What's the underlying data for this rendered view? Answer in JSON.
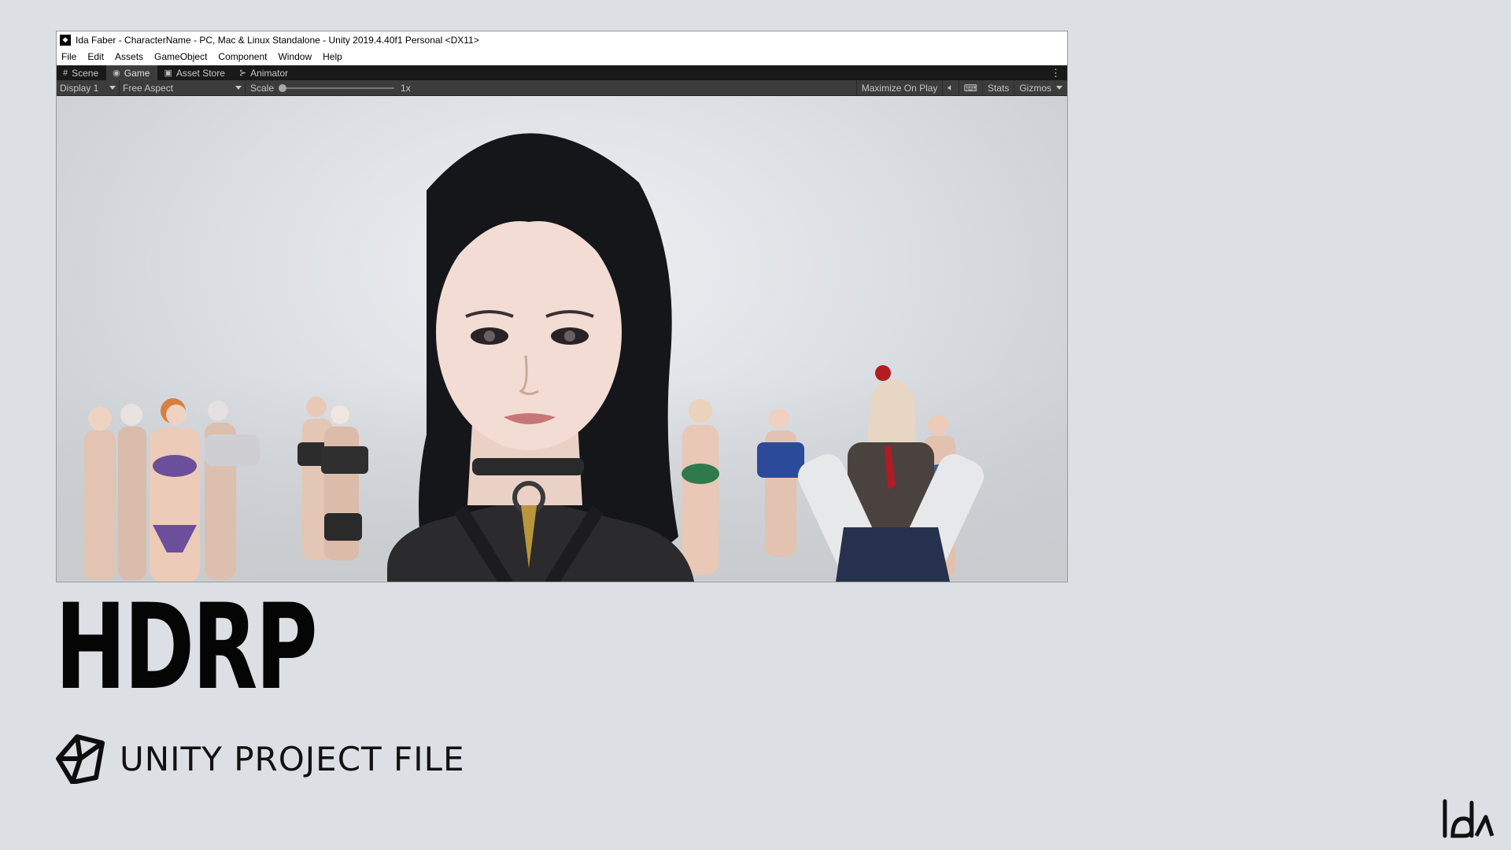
{
  "window": {
    "title": "Ida Faber - CharacterName - PC, Mac & Linux Standalone - Unity 2019.4.40f1 Personal <DX11>",
    "menu": [
      "File",
      "Edit",
      "Assets",
      "GameObject",
      "Component",
      "Window",
      "Help"
    ],
    "tabs": [
      {
        "label": "Scene",
        "icon": "grid-icon",
        "active": false
      },
      {
        "label": "Game",
        "icon": "gamepad-icon",
        "active": true
      },
      {
        "label": "Asset Store",
        "icon": "bag-icon",
        "active": false
      },
      {
        "label": "Animator",
        "icon": "animator-icon",
        "active": false
      }
    ],
    "toolbar": {
      "display": "Display 1",
      "aspect": "Free Aspect",
      "scale_label": "Scale",
      "scale_value": "1x",
      "maximize": "Maximize On Play",
      "stats": "Stats",
      "gizmos": "Gizmos"
    }
  },
  "headline": "HDRP",
  "subtitle": "UNITY PROJECT FILE",
  "colors": {
    "background": "#dcdfe4",
    "unity_dark": "#3c3c3c",
    "text": "#050505"
  }
}
